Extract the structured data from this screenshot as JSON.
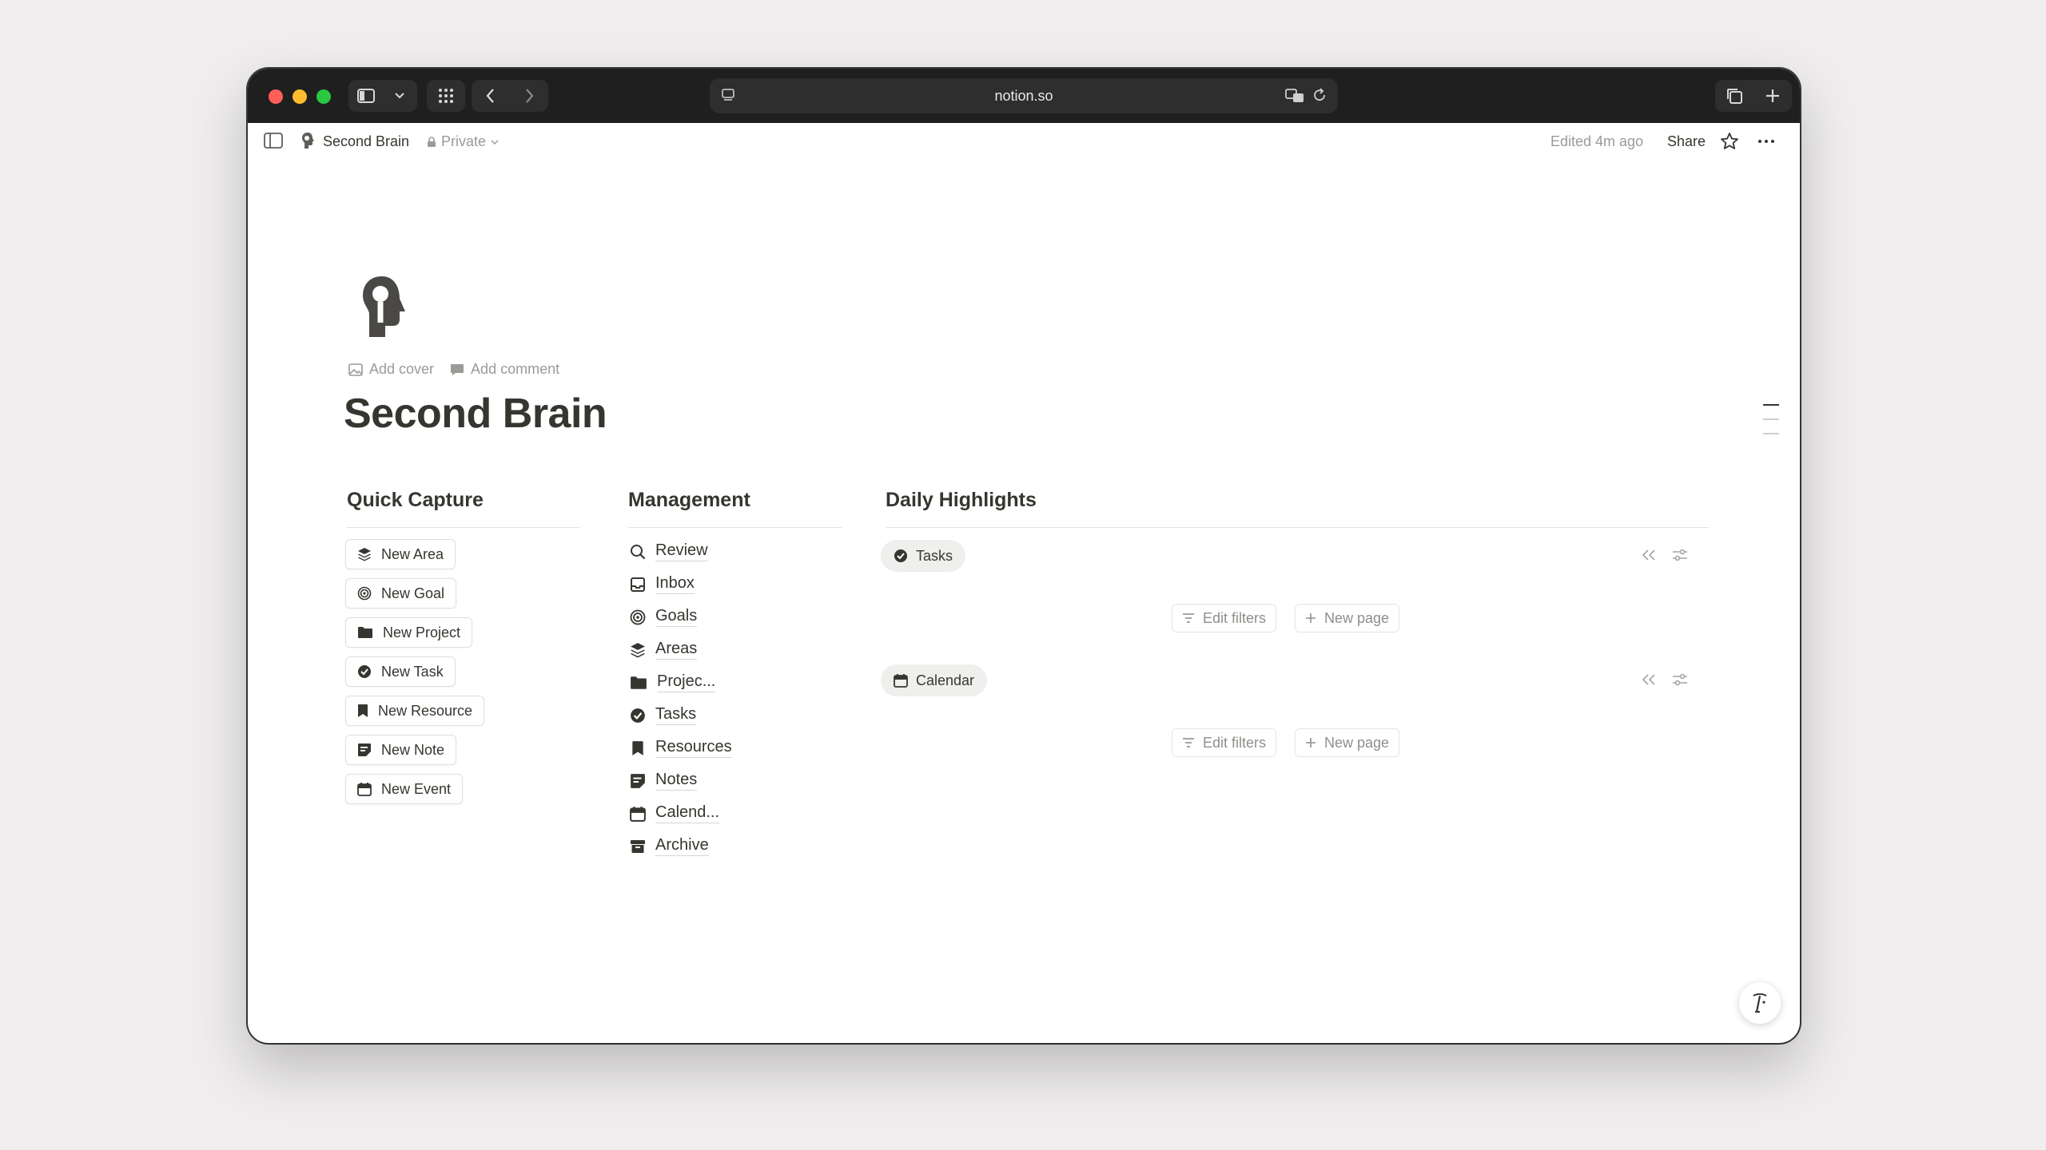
{
  "browser": {
    "url": "notion.so"
  },
  "topbar": {
    "breadcrumb": "Second Brain",
    "privacy": "Private",
    "edited": "Edited 4m ago",
    "share": "Share"
  },
  "page": {
    "add_cover": "Add cover",
    "add_comment": "Add comment",
    "title": "Second Brain"
  },
  "quick_capture": {
    "heading": "Quick Capture",
    "buttons": [
      {
        "label": "New Area",
        "icon": "layers-icon"
      },
      {
        "label": "New Goal",
        "icon": "target-icon"
      },
      {
        "label": "New Project",
        "icon": "folder-icon"
      },
      {
        "label": "New Task",
        "icon": "check-circle-icon"
      },
      {
        "label": "New Resource",
        "icon": "bookmark-icon"
      },
      {
        "label": "New Note",
        "icon": "note-icon"
      },
      {
        "label": "New Event",
        "icon": "calendar-icon"
      }
    ]
  },
  "management": {
    "heading": "Management",
    "items": [
      {
        "label": "Review",
        "icon": "search-icon"
      },
      {
        "label": "Inbox",
        "icon": "inbox-icon"
      },
      {
        "label": "Goals",
        "icon": "target-icon"
      },
      {
        "label": "Areas",
        "icon": "layers-icon"
      },
      {
        "label": "Projec...",
        "icon": "folder-icon"
      },
      {
        "label": "Tasks",
        "icon": "check-circle-icon"
      },
      {
        "label": "Resources",
        "icon": "bookmark-icon"
      },
      {
        "label": "Notes",
        "icon": "note-icon"
      },
      {
        "label": "Calend...",
        "icon": "calendar-icon"
      },
      {
        "label": "Archive",
        "icon": "archive-icon"
      }
    ]
  },
  "daily": {
    "heading": "Daily Highlights",
    "views": [
      {
        "label": "Tasks",
        "icon": "check-circle-icon",
        "edit_filters": "Edit filters",
        "new_page": "New page"
      },
      {
        "label": "Calendar",
        "icon": "calendar-icon",
        "edit_filters": "Edit filters",
        "new_page": "New page"
      }
    ]
  }
}
